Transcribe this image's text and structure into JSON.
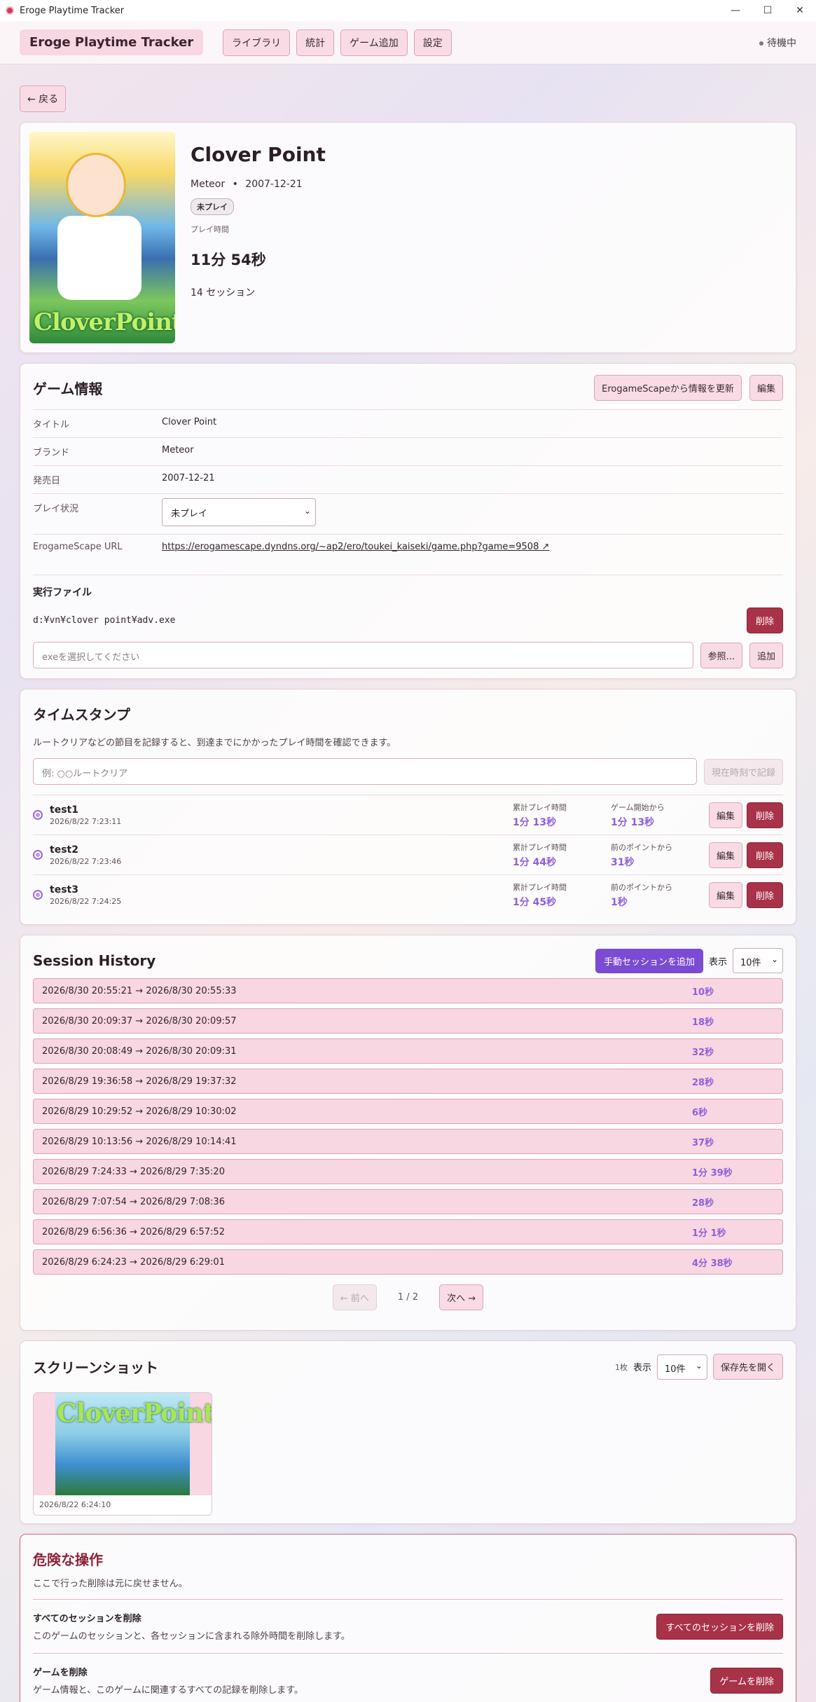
{
  "window": {
    "title": "Eroge Playtime Tracker",
    "minimize": "—",
    "maximize": "☐",
    "close": "✕"
  },
  "nav": {
    "brand": "Eroge Playtime Tracker",
    "items": [
      "ライブラリ",
      "統計",
      "ゲーム追加",
      "設定"
    ],
    "status": "待機中"
  },
  "back": "← 戻る",
  "game": {
    "cover_text": "CloverPoint",
    "title": "Clover Point",
    "brand": "Meteor",
    "sep": "•",
    "release": "2007-12-21",
    "status_badge": "未プレイ",
    "playtime_label": "プレイ時間",
    "playtime": "11分 54秒",
    "sessions": "14 セッション"
  },
  "info": {
    "heading": "ゲーム情報",
    "refresh_button": "ErogameScapeから情報を更新",
    "edit_button": "編集",
    "rows": [
      {
        "key": "タイトル",
        "value": "Clover Point"
      },
      {
        "key": "ブランド",
        "value": "Meteor"
      },
      {
        "key": "発売日",
        "value": "2007-12-21"
      }
    ],
    "status_key": "プレイ状況",
    "status_value": "未プレイ",
    "url_key": "ErogameScape URL",
    "url_value": "https://erogamescape.dyndns.org/~ap2/ero/toukei_kaiseki/game.php?game=9508 ↗",
    "exe_heading": "実行ファイル",
    "exe_path": "d:¥vn¥clover point¥adv.exe",
    "exe_delete": "削除",
    "exe_placeholder": "exeを選択してください",
    "browse_button": "参照...",
    "add_button": "追加"
  },
  "timestamps": {
    "heading": "タイムスタンプ",
    "description": "ルートクリアなどの節目を記録すると、到達までにかかったプレイ時間を確認できます。",
    "input_placeholder": "例: ○○ルートクリア",
    "record_button": "現在時刻で記録",
    "edit": "編集",
    "delete": "削除",
    "items": [
      {
        "name": "test1",
        "date": "2026/8/22 7:23:11",
        "cum_label": "累計プレイ時間",
        "cum": "1分 13秒",
        "diff_label": "ゲーム開始から",
        "diff": "1分 13秒"
      },
      {
        "name": "test2",
        "date": "2026/8/22 7:23:46",
        "cum_label": "累計プレイ時間",
        "cum": "1分 44秒",
        "diff_label": "前のポイントから",
        "diff": "31秒"
      },
      {
        "name": "test3",
        "date": "2026/8/22 7:24:25",
        "cum_label": "累計プレイ時間",
        "cum": "1分 45秒",
        "diff_label": "前のポイントから",
        "diff": "1秒"
      }
    ]
  },
  "history": {
    "heading": "Session History",
    "add_manual": "手動セッションを追加",
    "show_label": "表示",
    "page_size": "10件",
    "sessions": [
      {
        "range": "2026/8/30 20:55:21 → 2026/8/30 20:55:33",
        "duration": "10秒"
      },
      {
        "range": "2026/8/30 20:09:37 → 2026/8/30 20:09:57",
        "duration": "18秒"
      },
      {
        "range": "2026/8/30 20:08:49 → 2026/8/30 20:09:31",
        "duration": "32秒"
      },
      {
        "range": "2026/8/29 19:36:58 → 2026/8/29 19:37:32",
        "duration": "28秒"
      },
      {
        "range": "2026/8/29 10:29:52 → 2026/8/29 10:30:02",
        "duration": "6秒"
      },
      {
        "range": "2026/8/29 10:13:56 → 2026/8/29 10:14:41",
        "duration": "37秒"
      },
      {
        "range": "2026/8/29 7:24:33 → 2026/8/29 7:35:20",
        "duration": "1分 39秒"
      },
      {
        "range": "2026/8/29 7:07:54 → 2026/8/29 7:08:36",
        "duration": "28秒"
      },
      {
        "range": "2026/8/29 6:56:36 → 2026/8/29 6:57:52",
        "duration": "1分 1秒"
      },
      {
        "range": "2026/8/29 6:24:23 → 2026/8/29 6:29:01",
        "duration": "4分 38秒"
      }
    ],
    "prev": "← 前へ",
    "page": "1 / 2",
    "next": "次へ →"
  },
  "screenshots": {
    "heading": "スクリーンショット",
    "count": "1枚",
    "show_label": "表示",
    "page_size": "10件",
    "open_folder": "保存先を開く",
    "items": [
      {
        "date": "2026/8/22 6:24:10",
        "image_text": "CloverPoint"
      }
    ]
  },
  "danger": {
    "heading": "危険な操作",
    "description": "ここで行った削除は元に戻せません。",
    "sessions_title": "すべてのセッションを削除",
    "sessions_desc": "このゲームのセッションと、各セッションに含まれる除外時間を削除します。",
    "sessions_button": "すべてのセッションを削除",
    "game_title": "ゲームを削除",
    "game_desc": "ゲーム情報と、このゲームに関連するすべての記録を削除します。",
    "game_button": "ゲームを削除"
  }
}
